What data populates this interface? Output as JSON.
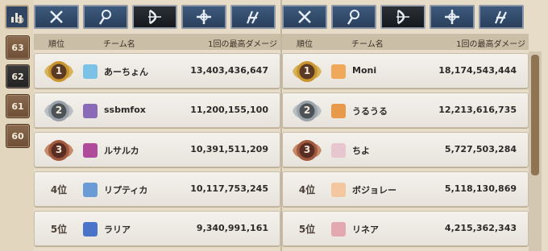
{
  "sidebar": {
    "top_icon": "ranking-chart-icon",
    "seasons": [
      {
        "label": "63",
        "active": false
      },
      {
        "label": "62",
        "active": true
      },
      {
        "label": "61",
        "active": false
      },
      {
        "label": "60",
        "active": false
      }
    ]
  },
  "tabs": [
    {
      "icon": "crossed-swords-icon",
      "active": false
    },
    {
      "icon": "magic-staff-icon",
      "active": false
    },
    {
      "icon": "bow-icon",
      "active": true
    },
    {
      "icon": "cross-star-icon",
      "active": false
    },
    {
      "icon": "wing-icon",
      "active": false
    }
  ],
  "columns": {
    "rank": "順位",
    "team": "チーム名",
    "score": "1回の最高ダメージ"
  },
  "left_ranking": [
    {
      "rank": "1",
      "name": "あーちょん",
      "score": "13,403,436,647"
    },
    {
      "rank": "2",
      "name": "ssbmfox",
      "score": "11,200,155,100"
    },
    {
      "rank": "3",
      "name": "ルサルカ",
      "score": "10,391,511,209"
    },
    {
      "rank": "4位",
      "name": "リプティカ",
      "score": "10,117,753,245"
    },
    {
      "rank": "5位",
      "name": "ラリア",
      "score": "9,340,991,161"
    }
  ],
  "right_ranking": [
    {
      "rank": "1",
      "name": "Moni",
      "score": "18,174,543,444"
    },
    {
      "rank": "2",
      "name": "うるうる",
      "score": "12,213,616,735"
    },
    {
      "rank": "3",
      "name": "ちよ",
      "score": "5,727,503,284"
    },
    {
      "rank": "4位",
      "name": "ボジョレー",
      "score": "5,118,130,869"
    },
    {
      "rank": "5位",
      "name": "リネア",
      "score": "4,215,362,343"
    }
  ],
  "colors": {
    "gold": "#c9952f",
    "silver": "#9aa1a8",
    "bronze": "#a0593e",
    "tab_blue": "#2f4a6c"
  }
}
